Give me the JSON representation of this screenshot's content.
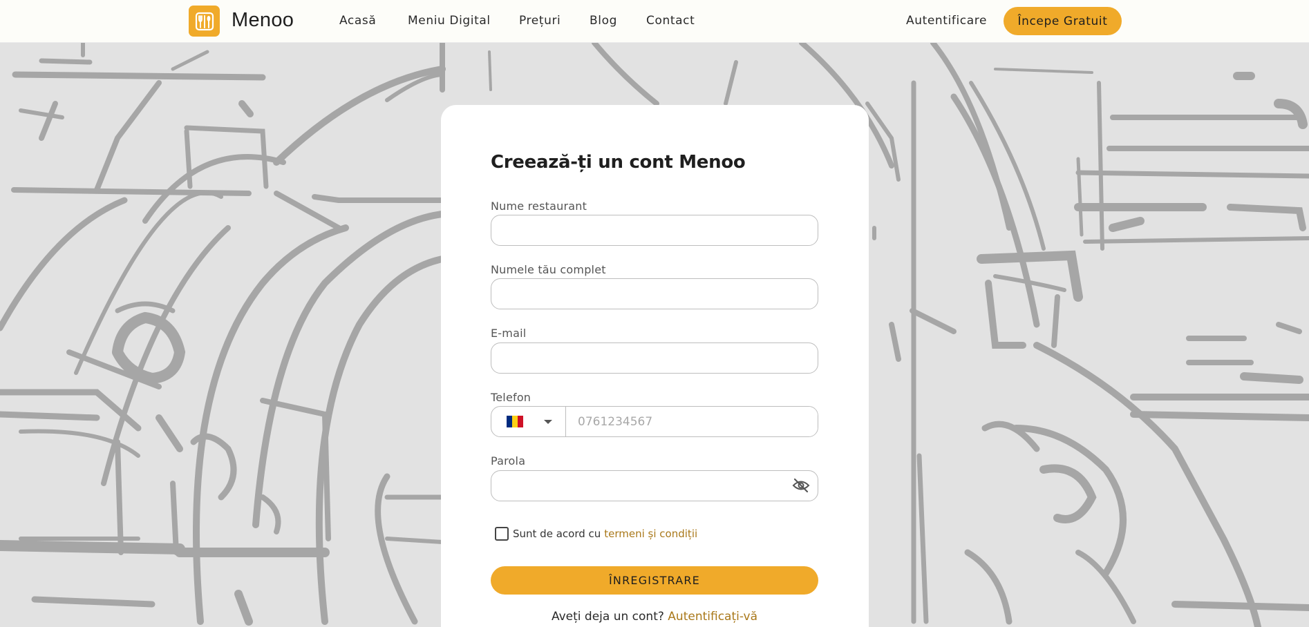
{
  "nav": {
    "brand": "Menoo",
    "links": [
      "Acasă",
      "Meniu Digital",
      "Prețuri",
      "Blog",
      "Contact"
    ],
    "login": "Autentificare",
    "cta": "Începe Gratuit"
  },
  "form": {
    "title": "Creează-ți un cont Menoo",
    "restaurant_label": "Nume restaurant",
    "restaurant_value": "",
    "fullname_label": "Numele tău complet",
    "fullname_value": "",
    "email_label": "E-mail",
    "email_value": "",
    "phone_label": "Telefon",
    "phone_placeholder": "0761234567",
    "phone_country_flag": [
      "#002B7F",
      "#FCD116",
      "#CE1126"
    ],
    "password_label": "Parola",
    "password_value": "",
    "agree_text": "Sunt de acord cu",
    "terms_link": "termeni și condiții",
    "agree_checked": false,
    "submit": "ÎNREGISTRARE",
    "have_account": "Aveți deja un cont?",
    "login_link": "Autentificați-vă"
  },
  "colors": {
    "accent": "#f0aa2a",
    "link": "#a9781a",
    "background": "#e2e2e2",
    "art": "#a6a6a6"
  },
  "icons": {
    "logo": "utensils-icon",
    "password_toggle": "eye-off-icon",
    "dropdown": "caret-down-icon"
  }
}
